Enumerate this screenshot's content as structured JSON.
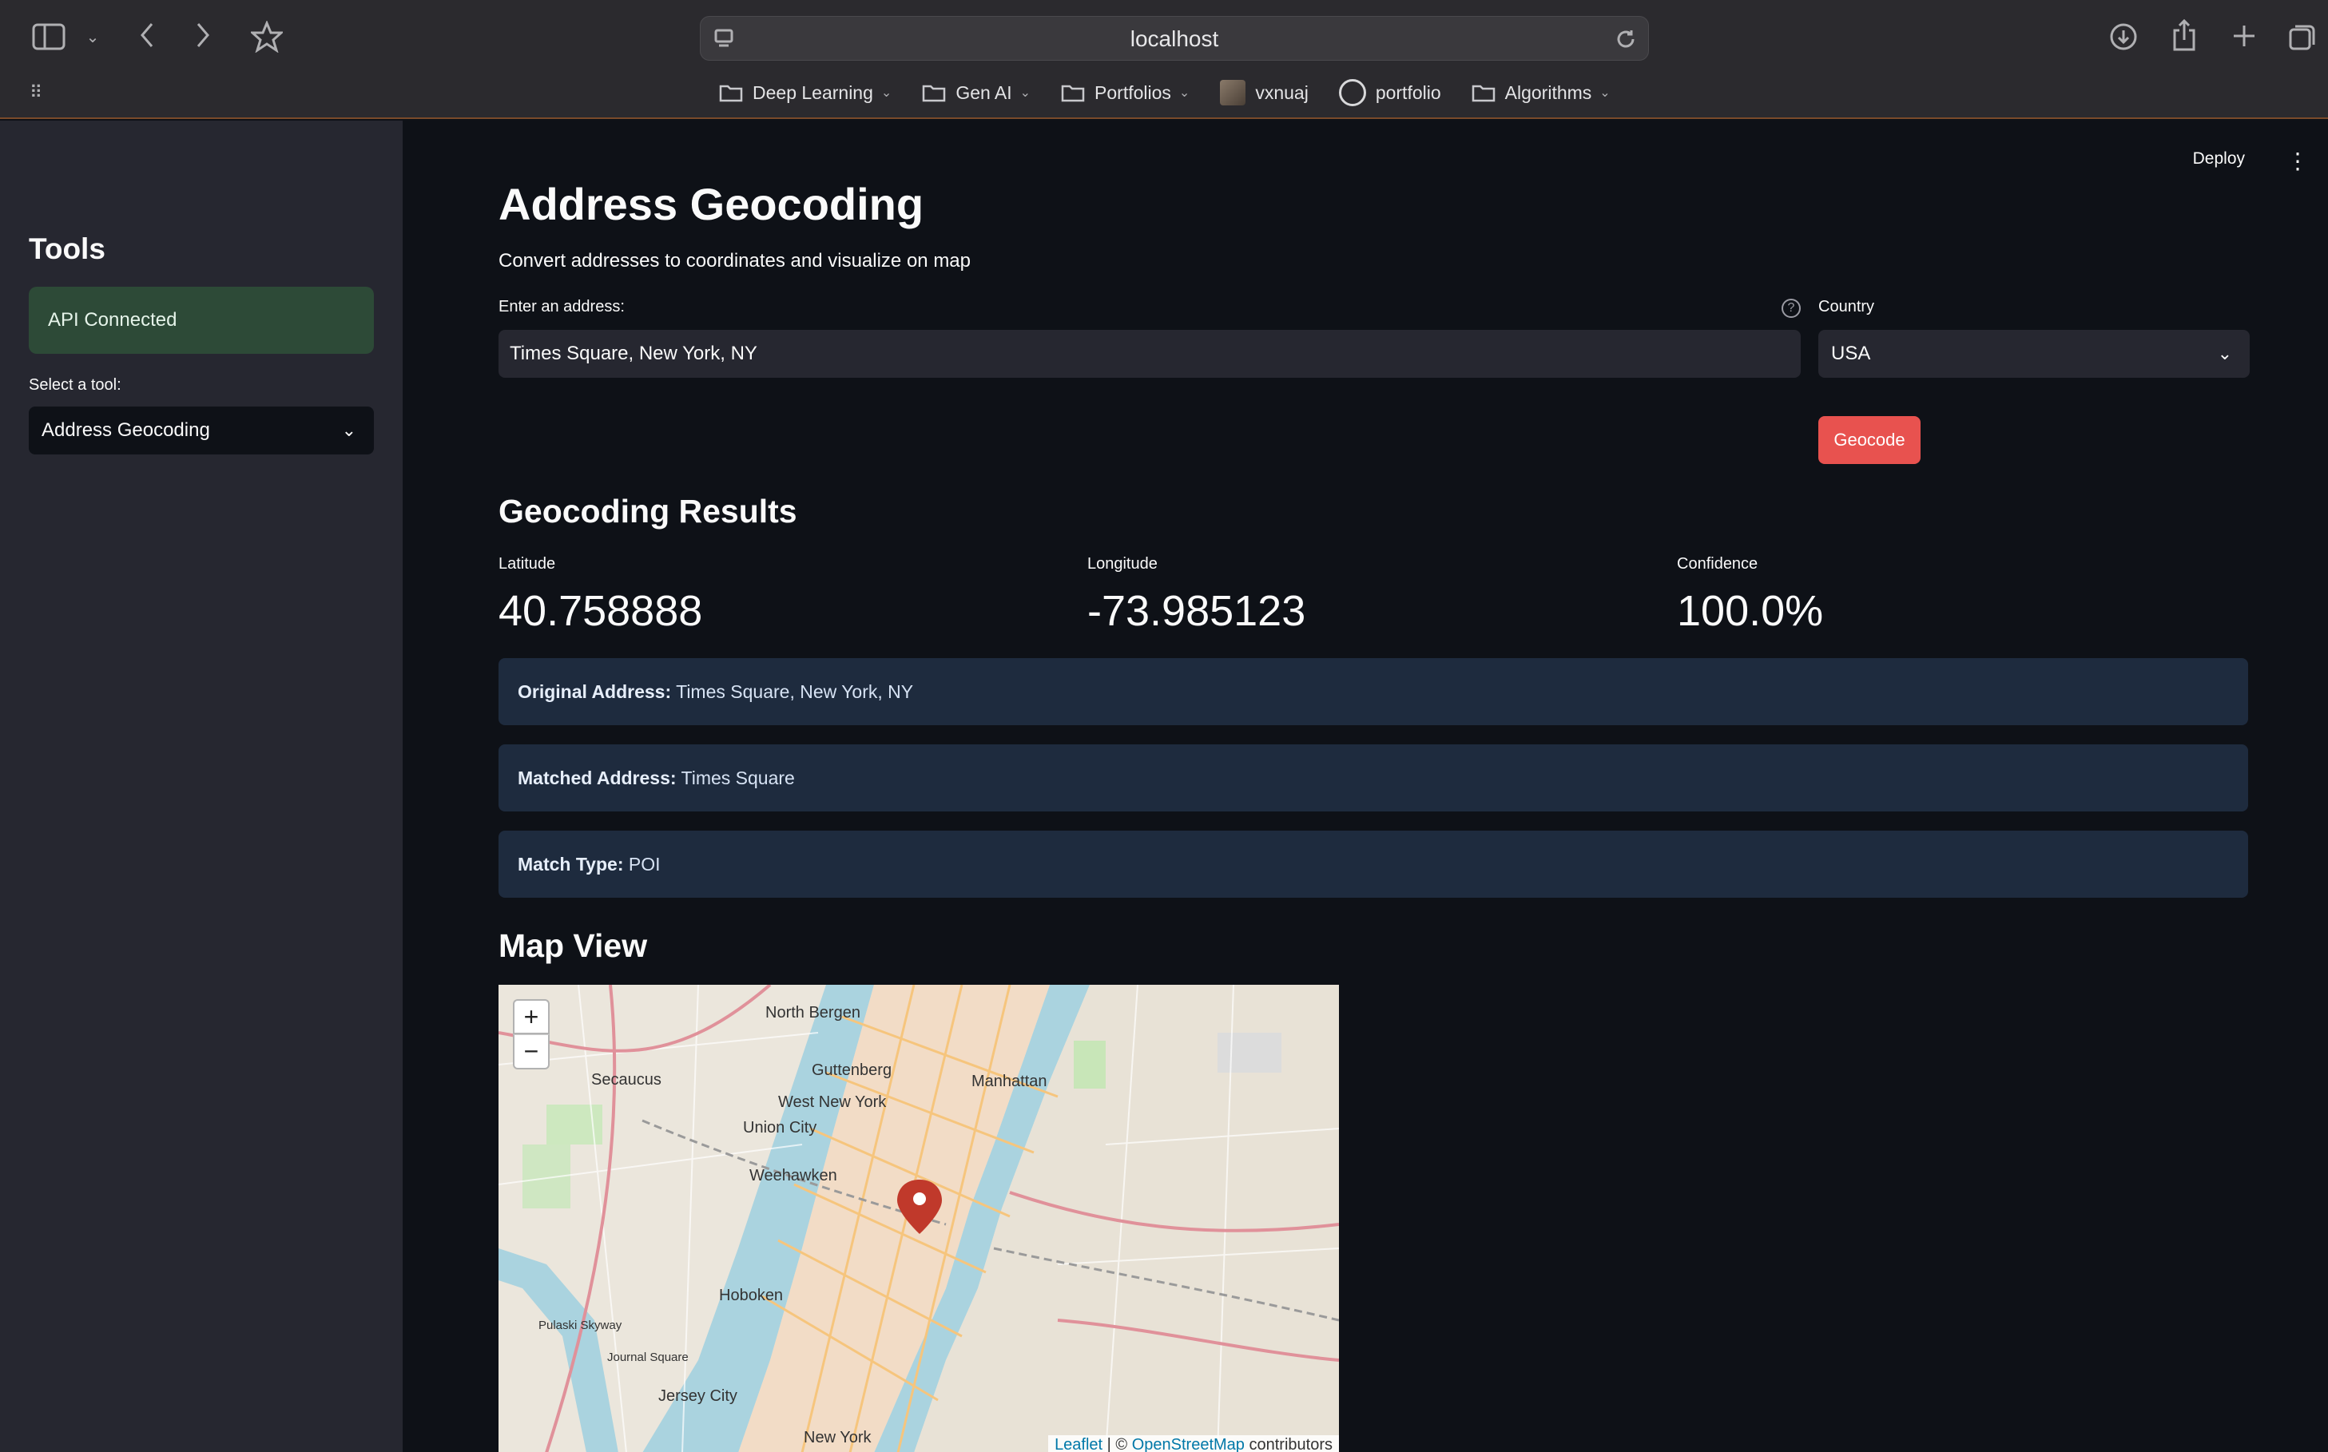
{
  "browser": {
    "url": "localhost",
    "bookmarks": [
      {
        "label": "Deep Learning",
        "icon": "folder-icon",
        "has_menu": true
      },
      {
        "label": "Gen AI",
        "icon": "folder-icon",
        "has_menu": true
      },
      {
        "label": "Portfolios",
        "icon": "folder-icon",
        "has_menu": true
      },
      {
        "label": "vxnuaj",
        "icon": "avatar-thumbnail",
        "has_menu": false
      },
      {
        "label": "portfolio",
        "icon": "globe-icon",
        "has_menu": false
      },
      {
        "label": "Algorithms",
        "icon": "folder-icon",
        "has_menu": true
      }
    ]
  },
  "sidebar": {
    "heading": "Tools",
    "status": "API Connected",
    "tool_label": "Select a tool:",
    "tool_selected": "Address Geocoding"
  },
  "header": {
    "deploy": "Deploy"
  },
  "main": {
    "title": "Address Geocoding",
    "subtitle": "Convert addresses to coordinates and visualize on map",
    "address_label": "Enter an address:",
    "address_value": "Times Square, New York, NY",
    "country_label": "Country",
    "country_value": "USA",
    "geocode_button": "Geocode",
    "results_title": "Geocoding Results",
    "metrics": [
      {
        "label": "Latitude",
        "value": "40.758888"
      },
      {
        "label": "Longitude",
        "value": "-73.985123"
      },
      {
        "label": "Confidence",
        "value": "100.0%"
      }
    ],
    "info": [
      {
        "key": "Original Address:",
        "value": "Times Square, New York, NY"
      },
      {
        "key": "Matched Address:",
        "value": "Times Square"
      },
      {
        "key": "Match Type:",
        "value": "POI"
      }
    ],
    "map_title": "Map View"
  },
  "map": {
    "zoom_in": "+",
    "zoom_out": "−",
    "labels": [
      "North Bergen",
      "Guttenberg",
      "West New York",
      "Secaucus",
      "Union City",
      "Weehawken",
      "Hoboken",
      "Jersey City",
      "New York",
      "Manhattan",
      "Journal Square",
      "Pulaski Skyway"
    ],
    "attribution": {
      "leaflet": "Leaflet",
      "sep": " | © ",
      "osm": "OpenStreetMap",
      "tail": " contributors"
    },
    "marker_color": "#c0392b"
  },
  "colors": {
    "accent": "#e8524f",
    "status_bg": "#2d4a37",
    "info_bg": "#1e2b3e"
  }
}
